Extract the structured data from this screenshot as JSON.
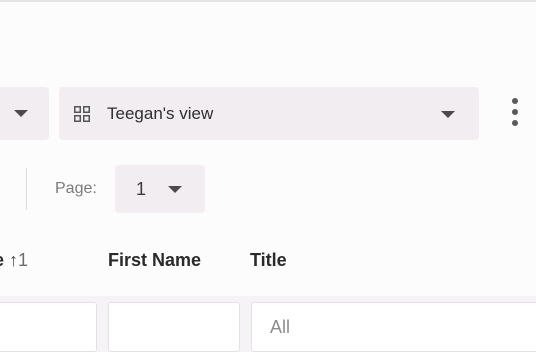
{
  "toolbar": {
    "view_select": {
      "label": "Teegan's view",
      "icon": "grid-icon"
    },
    "more_icon": "kebab-icon"
  },
  "pagination": {
    "page_label": "Page:",
    "page_value": "1"
  },
  "table": {
    "sorted_column_partial": "e",
    "sort_arrow": "↑",
    "sort_order": "1",
    "columns": [
      "First Name",
      "Title"
    ],
    "filters": {
      "first_name_value": "",
      "title_placeholder": "All"
    }
  },
  "colors": {
    "select_bg": "#f1edf1",
    "filter_band_bg": "#f6f3f6",
    "page_bg": "#fdfcfc"
  }
}
